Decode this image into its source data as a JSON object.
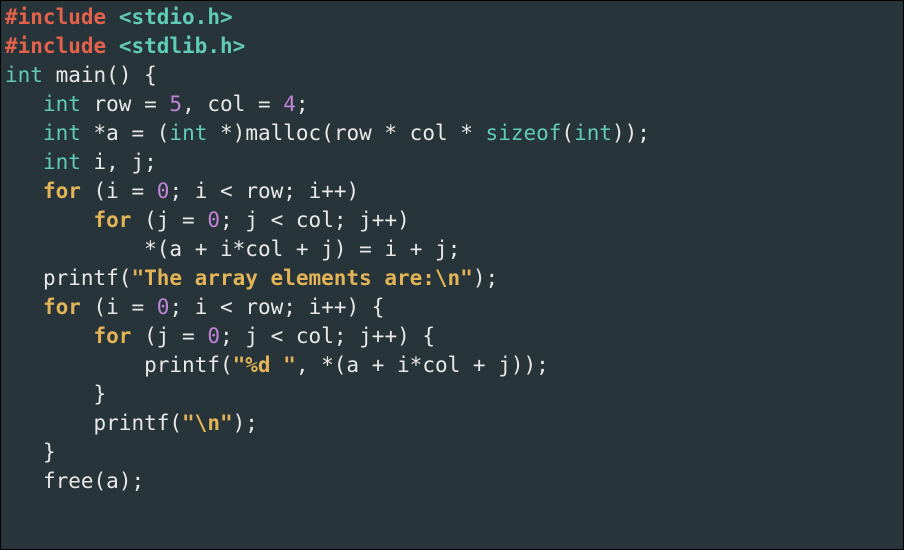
{
  "code": {
    "l1": {
      "pp": "#include",
      "inc": "<stdio.h>"
    },
    "l2": {
      "pp": "#include",
      "inc": "<stdlib.h>"
    },
    "l3": {
      "ty": "int",
      "fn": "main",
      "pn1": "()",
      "pn2": " {"
    },
    "l4": {
      "indent": "   ",
      "ty": "int",
      "id1": " row ",
      "op1": "=",
      "sp1": " ",
      "num1": "5",
      "pn1": ",",
      "id2": " col ",
      "op2": "=",
      "sp2": " ",
      "num2": "4",
      "pn2": ";"
    },
    "l5": {
      "indent": "   ",
      "ty1": "int",
      "id1": " *a ",
      "op1": "=",
      "sp1": " ",
      "pn1": "(",
      "ty2": "int",
      "id2": " *",
      "pn2": ")",
      "fn": "malloc",
      "pn3": "(",
      "id3": "row * col * ",
      "sz": "sizeof",
      "pn4": "(",
      "ty3": "int",
      "pn5": "));"
    },
    "l6": {
      "indent": "   ",
      "ty": "int",
      "rest": " i, j;"
    },
    "l7": {
      "indent": "   ",
      "kw": "for",
      "pn1": " (",
      "id1": "i ",
      "op1": "=",
      "sp1": " ",
      "num1": "0",
      "pn2": ";",
      "id2": " i ",
      "op2": "<",
      "id3": " row",
      "pn3": ";",
      "id4": " i",
      "op3": "++",
      "pn4": ")"
    },
    "l8": {
      "indent": "       ",
      "kw": "for",
      "pn1": " (",
      "id1": "j ",
      "op1": "=",
      "sp1": " ",
      "num1": "0",
      "pn2": ";",
      "id2": " j ",
      "op2": "<",
      "id3": " col",
      "pn3": ";",
      "id4": " j",
      "op3": "++",
      "pn4": ")"
    },
    "l9": {
      "indent": "           ",
      "id1": "*",
      "pn1": "(",
      "id2": "a ",
      "op1": "+",
      "id3": " i",
      "op2": "*",
      "id4": "col ",
      "op3": "+",
      "id5": " j",
      "pn2": ")",
      "sp1": " ",
      "op4": "=",
      "id6": " i ",
      "op5": "+",
      "id7": " j",
      "pn3": ";"
    },
    "l10": {
      "indent": "   ",
      "fn": "printf",
      "pn1": "(",
      "str": "\"The array elements are:\\n\"",
      "pn2": ");"
    },
    "l11": {
      "indent": "   ",
      "kw": "for",
      "pn1": " (",
      "id1": "i ",
      "op1": "=",
      "sp1": " ",
      "num1": "0",
      "pn2": ";",
      "id2": " i ",
      "op2": "<",
      "id3": " row",
      "pn3": ";",
      "id4": " i",
      "op3": "++",
      "pn4": ") {"
    },
    "l12": {
      "indent": "       ",
      "kw": "for",
      "pn1": " (",
      "id1": "j ",
      "op1": "=",
      "sp1": " ",
      "num1": "0",
      "pn2": ";",
      "id2": " j ",
      "op2": "<",
      "id3": " col",
      "pn3": ";",
      "id4": " j",
      "op3": "++",
      "pn4": ") {"
    },
    "l13": {
      "indent": "           ",
      "fn": "printf",
      "pn1": "(",
      "str": "\"%d \"",
      "pn2": ", ",
      "id1": "*",
      "pn3": "(",
      "id2": "a ",
      "op1": "+",
      "id3": " i",
      "op2": "*",
      "id4": "col ",
      "op3": "+",
      "id5": " j",
      "pn4": "));"
    },
    "l14": {
      "indent": "       ",
      "pn": "}"
    },
    "l15": {
      "indent": "       ",
      "fn": "printf",
      "pn1": "(",
      "str": "\"\\n\"",
      "pn2": ");"
    },
    "l16": {
      "indent": "   ",
      "pn": "}"
    },
    "l17": {
      "indent": "   ",
      "fn": "free",
      "pn1": "(",
      "id": "a",
      "pn2": ");"
    }
  }
}
